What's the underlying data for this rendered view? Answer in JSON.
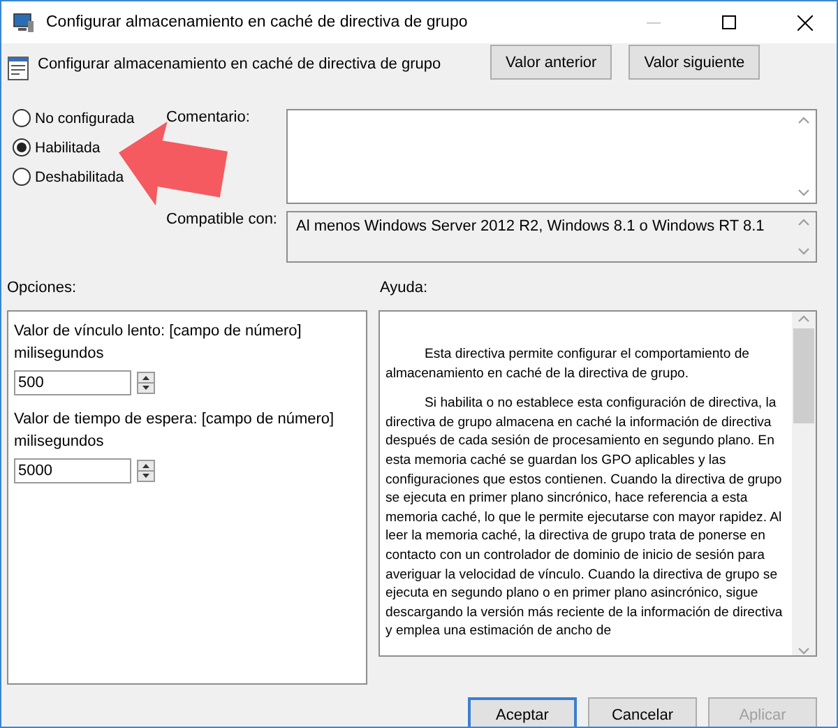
{
  "window": {
    "title": "Configurar almacenamiento en caché de directiva de grupo"
  },
  "header": {
    "title": "Configurar almacenamiento en caché de directiva de grupo",
    "buttons": [
      {
        "label": "Valor anterior"
      },
      {
        "label": "Valor siguiente"
      }
    ]
  },
  "state_options": [
    {
      "label": "No configurada",
      "selected": false
    },
    {
      "label": "Habilitada",
      "selected": true
    },
    {
      "label": "Deshabilitada",
      "selected": false
    }
  ],
  "comment": {
    "label": "Comentario:"
  },
  "supported_on": {
    "label": "Compatible con:",
    "value": "Al menos Windows Server 2012 R2, Windows 8.1 o Windows RT 8.1"
  },
  "options": {
    "label": "Opciones:",
    "fields": [
      {
        "label": "Valor de vínculo lento: [campo de número] milisegundos",
        "value": "500"
      },
      {
        "label": "Valor de tiempo de espera: [campo de número] milisegundos",
        "value": "5000"
      }
    ]
  },
  "help": {
    "label": "Ayuda:",
    "paragraphs": [
      "Esta directiva permite configurar el comportamiento de almacenamiento en caché de la directiva de grupo.",
      "Si habilita o no establece esta configuración de directiva, la directiva de grupo almacena en caché la información de directiva después de cada sesión de procesamiento en segundo plano. En esta memoria caché se guardan los GPO aplicables y las configuraciones que estos contienen. Cuando la directiva de grupo se ejecuta en primer plano sincrónico, hace referencia a esta memoria caché, lo que le permite ejecutarse con mayor rapidez. Al leer la memoria caché, la directiva de grupo trata de ponerse en contacto con un controlador de dominio de inicio de sesión para averiguar la velocidad de vínculo. Cuando la directiva de grupo se ejecuta en segundo plano o en primer plano asincrónico, sigue descargando la versión más reciente de la información de directiva y emplea una estimación de ancho de"
    ]
  },
  "footer": {
    "buttons": [
      {
        "label": "Aceptar",
        "disabled": false,
        "default": true
      },
      {
        "label": "Cancelar",
        "disabled": false,
        "default": false
      },
      {
        "label": "Aplicar",
        "disabled": true,
        "default": false
      }
    ]
  }
}
